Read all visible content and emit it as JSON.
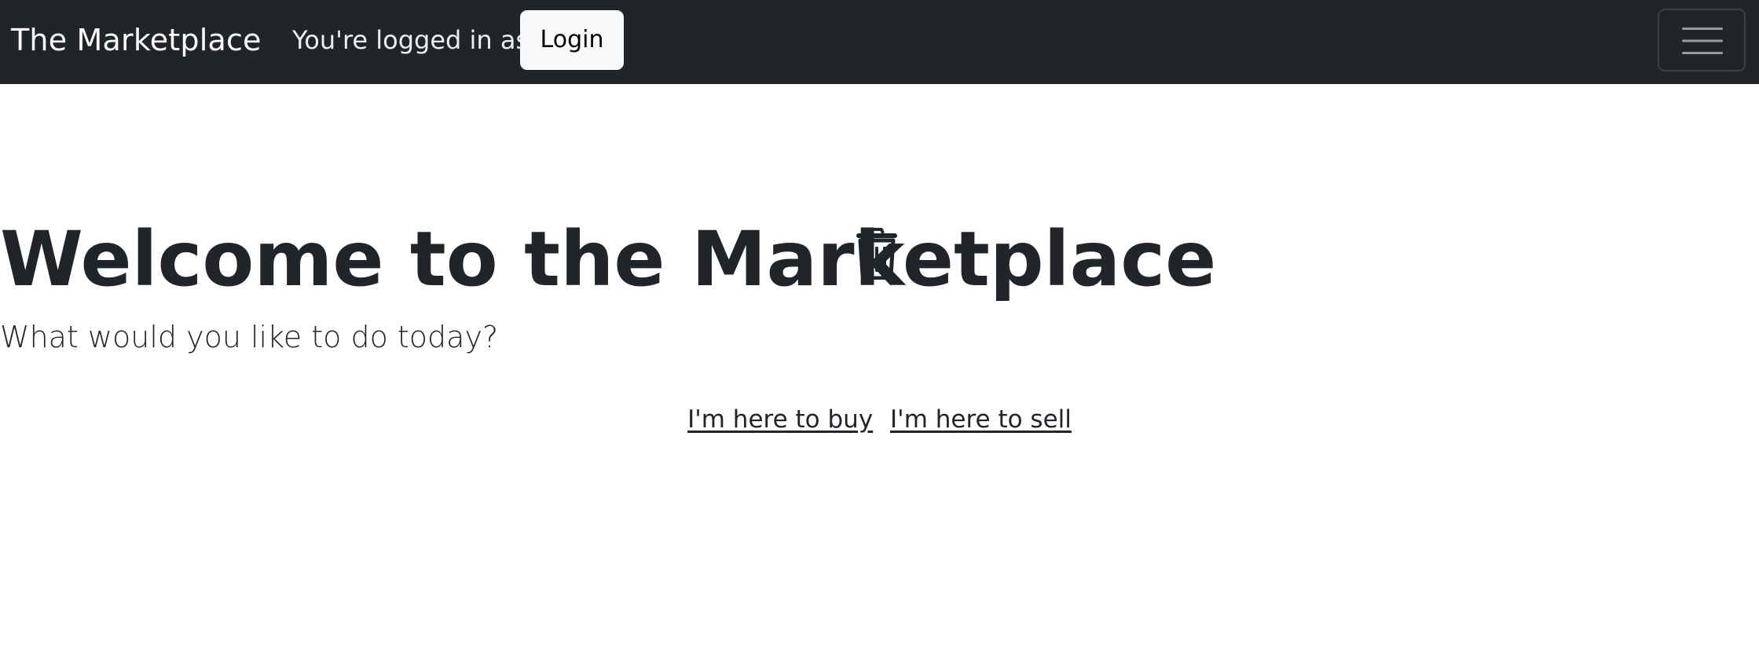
{
  "navbar": {
    "brand": "The Marketplace",
    "logged_in_text": "You're logged in as",
    "login_button": "Login",
    "toggler_icon": "hamburger-menu-icon"
  },
  "hero": {
    "icon": "trash-icon",
    "title": "Welcome to the Marketplace",
    "subtitle": "What would you like to do today?",
    "links": [
      {
        "label": "I'm here to buy"
      },
      {
        "label": "I'm here to sell"
      }
    ]
  },
  "colors": {
    "navbar_bg": "#212529",
    "text": "#212529",
    "login_bg": "#f8f9fa"
  }
}
